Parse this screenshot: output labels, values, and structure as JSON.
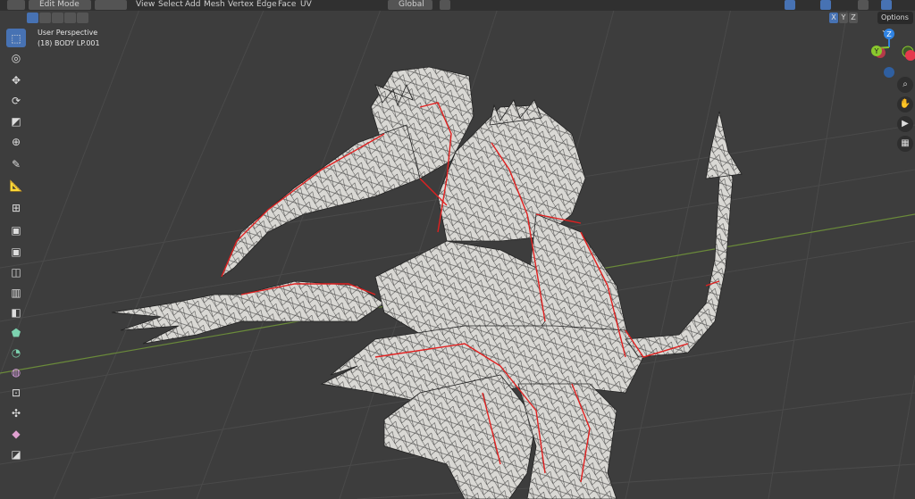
{
  "header": {
    "mode": "Edit Mode",
    "menus": [
      "View",
      "Select",
      "Add",
      "Mesh",
      "Vertex",
      "Edge",
      "Face",
      "UV"
    ],
    "orientation": "Global",
    "options_label": "Options",
    "axis_buttons": [
      "X",
      "Y",
      "Z"
    ]
  },
  "viewport": {
    "view_name": "User Perspective",
    "object_name": "(18) BODY LP.001"
  },
  "gizmo": {
    "z": "Z",
    "y": "Y",
    "colors": {
      "x": "#e5394e",
      "y": "#8ac82d",
      "z": "#2f83e3"
    }
  },
  "toolbar": {
    "tools": [
      "select-box",
      "cursor",
      "move",
      "rotate",
      "scale",
      "transform",
      "annotate",
      "measure",
      "add-cube",
      "extrude",
      "inset",
      "bevel",
      "loop-cut",
      "knife",
      "poly-build",
      "spin",
      "smooth",
      "shrink-fatten",
      "shear",
      "rip",
      "to-sphere"
    ]
  },
  "colors": {
    "accent": "#4772b3",
    "seam": "#e02020",
    "background": "#3d3d3d"
  }
}
